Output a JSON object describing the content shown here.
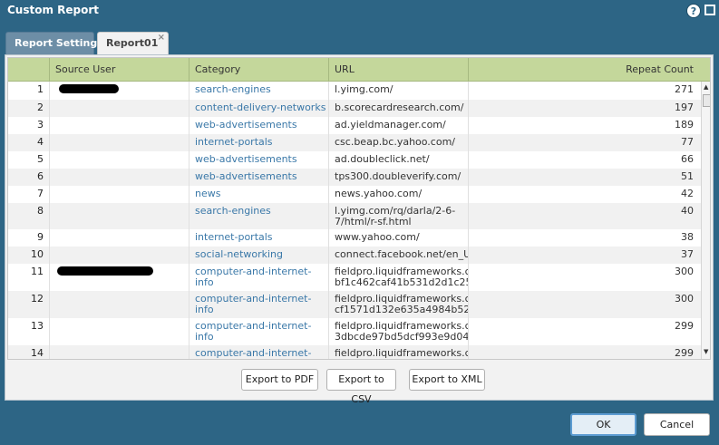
{
  "window": {
    "title": "Custom Report",
    "help_glyph": "?"
  },
  "tabs": [
    {
      "label": "Report Setting"
    },
    {
      "label": "Report01",
      "close_glyph": "×"
    }
  ],
  "grid": {
    "columns": {
      "user": "Source User",
      "category": "Category",
      "url": "URL",
      "count": "Repeat Count"
    },
    "rows": [
      {
        "num": "1",
        "category": "search-engines",
        "url": "l.yimg.com/",
        "count": "271",
        "redacted_user": true
      },
      {
        "num": "2",
        "category": "content-delivery-networks",
        "url": "b.scorecardresearch.com/",
        "count": "197"
      },
      {
        "num": "3",
        "category": "web-advertisements",
        "url": "ad.yieldmanager.com/",
        "count": "189"
      },
      {
        "num": "4",
        "category": "internet-portals",
        "url": "csc.beap.bc.yahoo.com/",
        "count": "77"
      },
      {
        "num": "5",
        "category": "web-advertisements",
        "url": "ad.doubleclick.net/",
        "count": "66"
      },
      {
        "num": "6",
        "category": "web-advertisements",
        "url": "tps300.doubleverify.com/",
        "count": "51"
      },
      {
        "num": "7",
        "category": "news",
        "url": "news.yahoo.com/",
        "count": "42"
      },
      {
        "num": "8",
        "category": "search-engines",
        "url": "l.yimg.com/rq/darla/2-6-\n7/html/r-sf.html",
        "count": "40"
      },
      {
        "num": "9",
        "category": "internet-portals",
        "url": "www.yahoo.com/",
        "count": "38"
      },
      {
        "num": "10",
        "category": "social-networking",
        "url": "connect.facebook.net/en_U...",
        "count": "37"
      },
      {
        "num": "11",
        "category": "computer-and-internet-info",
        "url": "fieldpro.liquidframeworks.c...\nbf1c462caf41b531d2d1c25...",
        "count": "300",
        "redacted_user": true
      },
      {
        "num": "12",
        "category": "computer-and-internet-info",
        "url": "fieldpro.liquidframeworks.c...\ncf1571d132e635a4984b522...",
        "count": "300"
      },
      {
        "num": "13",
        "category": "computer-and-internet-info",
        "url": "fieldpro.liquidframeworks.c...\n3dbcde97bd5dcf993e9d045...",
        "count": "299"
      },
      {
        "num": "14",
        "category": "computer-and-internet-info",
        "url": "fieldpro.liquidframeworks.c...",
        "count": "299"
      }
    ]
  },
  "export": {
    "pdf": "Export to PDF",
    "csv": "Export to CSV",
    "xml": "Export to XML"
  },
  "footer": {
    "ok": "OK",
    "cancel": "Cancel"
  },
  "colors": {
    "window_bg": "#2d6585",
    "header_green": "#c4d79b",
    "link_blue": "#3a78a8",
    "ok_border": "#5d9cd2"
  },
  "icons": {
    "help": "help-icon",
    "maximize": "maximize-icon",
    "tab_close": "close-icon",
    "scroll_up": "arrow-up-icon",
    "scroll_down": "arrow-down-icon"
  }
}
